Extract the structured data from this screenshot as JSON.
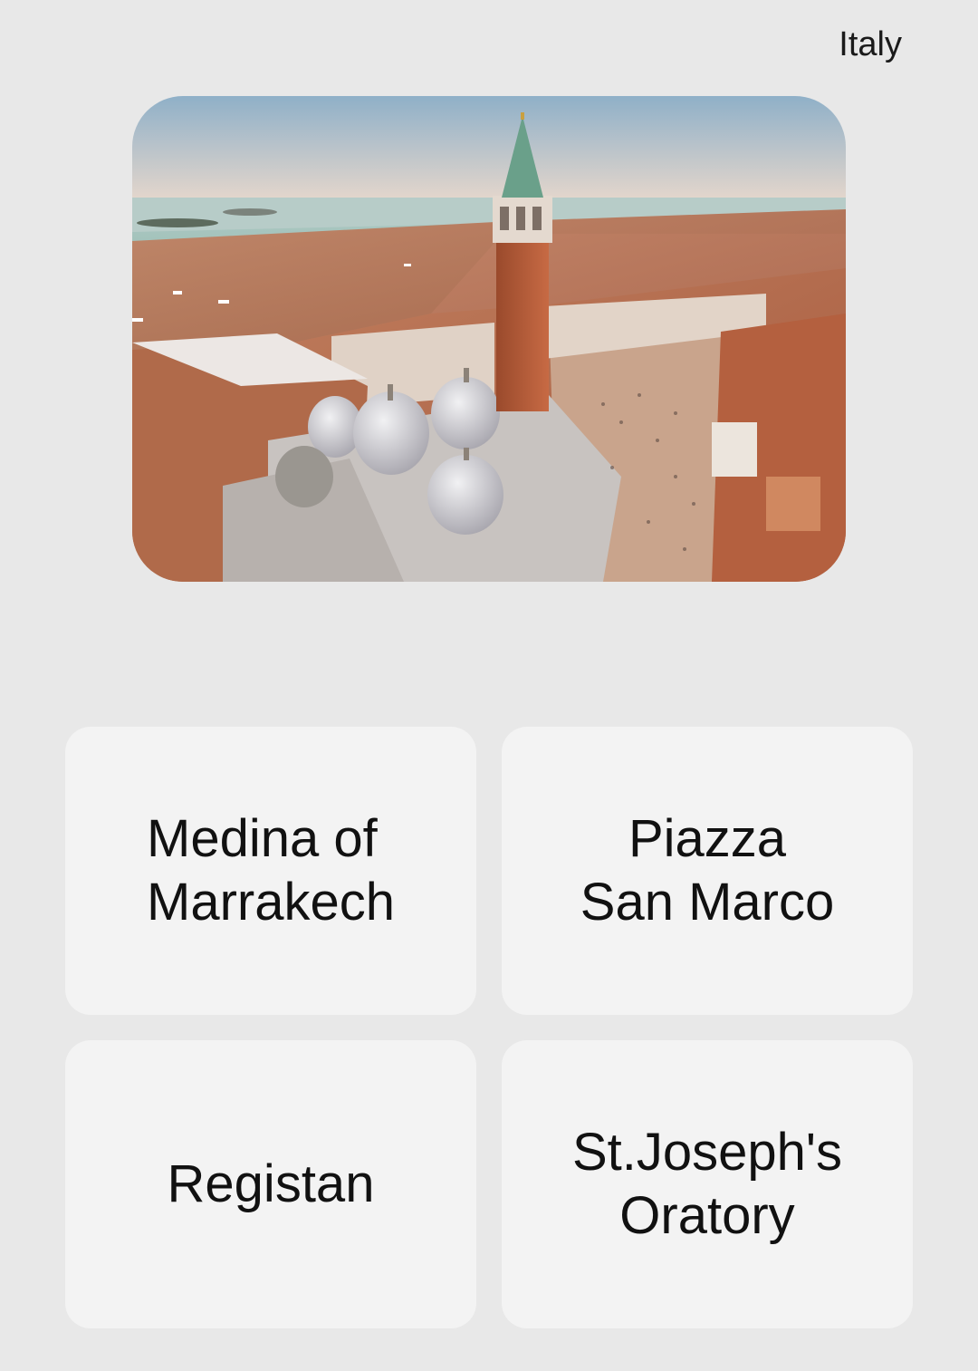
{
  "header": {
    "category": "Italy"
  },
  "photo": {
    "icon": "landmark-photo"
  },
  "answers": [
    {
      "label": "Medina of\nMarrakech"
    },
    {
      "label": "Piazza\nSan Marco"
    },
    {
      "label": "Registan"
    },
    {
      "label": "St.Joseph's\nOratory"
    }
  ],
  "colors": {
    "background": "#e8e8e8",
    "card": "#f3f3f3",
    "text": "#111111"
  }
}
